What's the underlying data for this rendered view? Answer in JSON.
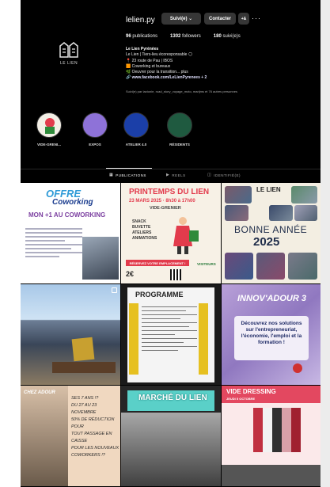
{
  "profile": {
    "username": "lelien.py",
    "follow_label": "Suivi(e) ⌄",
    "contact_label": "Contacter",
    "suggest_icon": "+& ",
    "more_label": "···",
    "logo_text": "LE LIEN",
    "stats": {
      "posts": "96",
      "posts_label": "publications",
      "followers": "1302",
      "followers_label": "followers",
      "following": "180",
      "following_label": "suivi(e)s"
    },
    "bio": {
      "name": "Le Lien Pyrénées",
      "line1": "Le Lien | Tiers-lieu écoresponsable 🌕",
      "line2": "📍 23 route de Pau | IBOS",
      "line3": "🟧 Coworking et bureaux",
      "line4": "🌿 Oeuvrer pour la transition... plus",
      "link": "🔗 www.facebook.com/LeLienPyrenees + 2"
    },
    "followed_by": "Suivi(e) par lactonie, road_story_voyage_moto, marijms et 76 autres personnes"
  },
  "highlights": [
    {
      "label": "VIDE-GRENI...",
      "color": "#f3efe6"
    },
    {
      "label": "EXPOS",
      "color": "#8e72d8"
    },
    {
      "label": "ATELIER 4.0",
      "color": "#1b3fa8"
    },
    {
      "label": "RÉSIDENTS",
      "color": "#1f5a40"
    }
  ],
  "tabs": [
    {
      "label": "PUBLICATIONS",
      "icon": "grid-icon"
    },
    {
      "label": "REELS",
      "icon": "reels-icon"
    },
    {
      "label": "IDENTIFIÉ(E)",
      "icon": "tagged-icon"
    }
  ],
  "posts": {
    "p1": {
      "title1": "OFFRE",
      "title2": "Coworking",
      "title3": "MON +1 AU COWORKING"
    },
    "p2": {
      "title": "PRINTEMPS DU LIEN",
      "date": "23 MARS 2025 · 8h30 à 17h00",
      "sub": "VIDE-GRENIER",
      "items": [
        "SNACK",
        "BUVETTE",
        "ATELIERS",
        "ANIMATIONS"
      ],
      "cta": "RÉSERVEZ VOTRE EMPLACEMENT !",
      "price": "2€",
      "visit": "VISITEURS"
    },
    "p3": {
      "brand": "LE LIEN",
      "greeting": "BONNE ANNÉE",
      "year": "2025"
    },
    "p5": {
      "title": "PROGRAMME"
    },
    "p6": {
      "title": "INNOV'ADOUR 3",
      "text": "Découvrez nos solutions sur l'entrepreneuriat, l'économie, l'emploi et la formation !"
    },
    "p7": {
      "brand": "CHEZ ADOUR",
      "lines": [
        "DU 27 AU 23 NOVEMBRE",
        "SES 7 ANS !?",
        "50% DE RÉDUCTION POUR",
        "TOUT PASSAGE EN CAISSE",
        "POUR LES NOUVEAUX",
        "COWORKERS !?"
      ]
    },
    "p8": {
      "title": "MARCHÉ DU LIEN"
    },
    "p9": {
      "title": "VIDE DRESSING",
      "sub": "JEUDI 5 OCTOBRE"
    }
  }
}
